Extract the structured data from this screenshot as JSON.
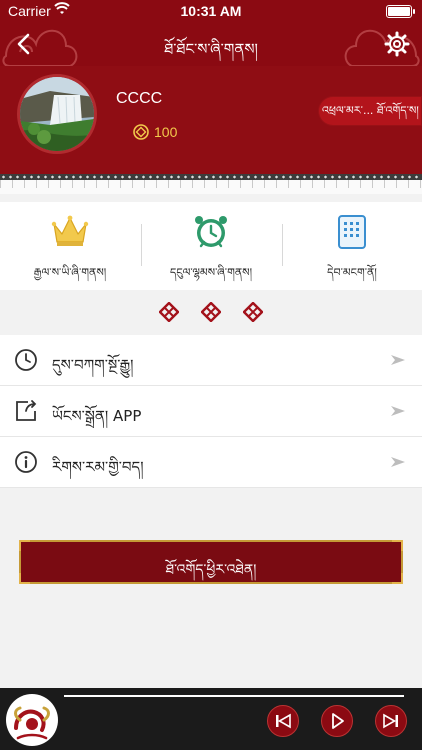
{
  "status_bar": {
    "carrier": "Carrier",
    "time": "10:31 AM"
  },
  "nav": {
    "title": "ཐོ་ཐོང་ས་ཞི་གནས།",
    "back_icon": "chevron-left-icon",
    "settings_icon": "gear-icon"
  },
  "profile": {
    "username": "CCCC",
    "coins": "100",
    "coin_icon": "coin-icon",
    "signin_label": "འཕྲལ་མར་... ཐོ་འགོད་ས།"
  },
  "quick_menu": [
    {
      "label": "རྒྱལ་ས་ཡི་ཞི་གནས།",
      "icon": "crown-icon"
    },
    {
      "label": "དངུལ་ལྷམས་ཞི་གནས།",
      "icon": "alarm-clock-icon"
    },
    {
      "label": "དེབ་མངག་ནོ།",
      "icon": "keypad-icon"
    }
  ],
  "list": [
    {
      "label": "དུས་བཀག་སྔོ་རྒྱུ།",
      "icon": "clock-icon"
    },
    {
      "label": "ཡོངས་སྒྲོན། APP",
      "icon": "share-icon"
    },
    {
      "label": "རིགས་རམ་གྱི་བད།",
      "icon": "info-icon"
    }
  ],
  "logout": {
    "label": "ཐོ་འགོད་ཕྱིར་འཐེན།"
  },
  "player": {
    "logo_icon": "yak-logo-icon",
    "prev_icon": "skip-back-icon",
    "play_icon": "play-icon",
    "next_icon": "skip-forward-icon"
  },
  "colors": {
    "primary": "#8b0a12",
    "gold": "#f2c94c",
    "teal": "#2e9a6b",
    "blue": "#3a8fd0"
  }
}
